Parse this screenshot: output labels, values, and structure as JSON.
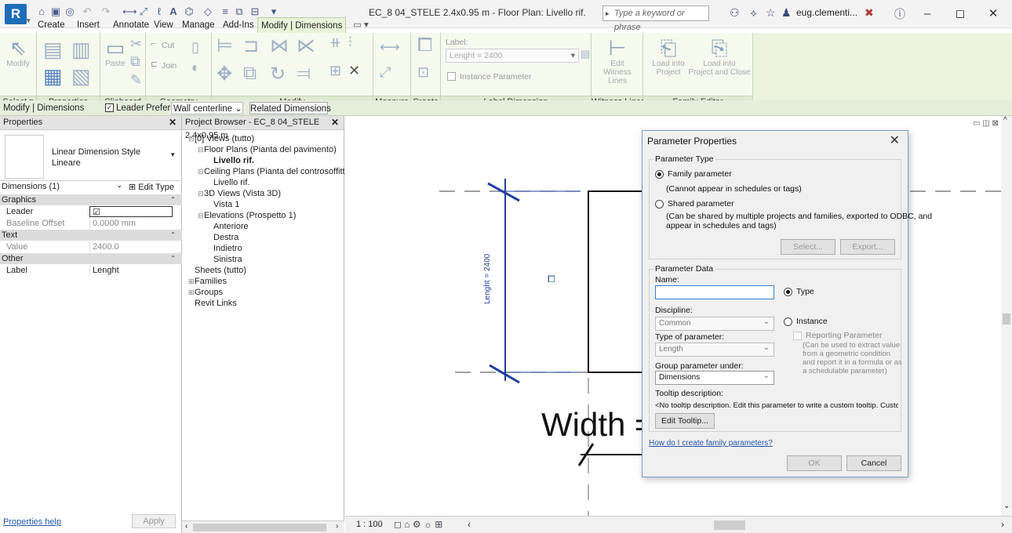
{
  "titlebar": {
    "logo": "R",
    "doc_title": "EC_8 04_STELE 2.4x0.95 m - Floor Plan: Livello rif.",
    "search_placeholder": "Type a keyword or phrase",
    "user": "eug.clementi...",
    "minimize": "–",
    "restore": "◻",
    "close": "✕"
  },
  "tabs": [
    "Create",
    "Insert",
    "Annotate",
    "View",
    "Manage",
    "Add-Ins",
    "Modify | Dimensions"
  ],
  "ribbon": {
    "panels": {
      "select": "Select ▾",
      "properties": "Properties",
      "clipboard": "Clipboard",
      "geometry": "Geometry",
      "modify": "Modify",
      "measure": "Measure",
      "create": "Create",
      "label_dimension": "Label Dimension",
      "witness_lines": "Witness Lines",
      "family_editor": "Family Editor"
    },
    "modify_btn": "Modify",
    "paste_btn": "Paste",
    "cut_btn": "Cut",
    "join_btn": "Join",
    "label_caption": "Label:",
    "label_value": "Lenght = 2400",
    "instance_parameter": "Instance Parameter",
    "edit_witness_1": "Edit",
    "edit_witness_2": "Witness Lines",
    "load_into_project_1": "Load into",
    "load_into_project_2": "Project",
    "load_close_1": "Load into",
    "load_close_2": "Project and Close"
  },
  "optionsbar": {
    "context": "Modify | Dimensions",
    "leader": "Leader",
    "prefer_label": "Prefer:",
    "prefer_value": "Wall centerline",
    "related": "Related Dimensions"
  },
  "properties": {
    "header": "Properties",
    "type_name": "Linear Dimension Style",
    "type_sub": "Lineare",
    "selector": "Dimensions (1)",
    "edit_type": "Edit Type",
    "rows": [
      {
        "kind": "cat",
        "k": "Graphics"
      },
      {
        "kind": "row",
        "k": "Leader",
        "v": "☑"
      },
      {
        "kind": "faint",
        "k": "Baseline Offset",
        "v": "0.0000 mm"
      },
      {
        "kind": "cat",
        "k": "Text"
      },
      {
        "kind": "faint",
        "k": "Value",
        "v": "2400.0"
      },
      {
        "kind": "cat",
        "k": "Other"
      },
      {
        "kind": "row",
        "k": "Label",
        "v": "Lenght"
      }
    ],
    "help": "Properties help",
    "apply": "Apply"
  },
  "browser": {
    "header": "Project Browser - EC_8 04_STELE 2.4x0.95 m",
    "nodes": [
      {
        "t": "[0] Views (tutto)",
        "d": 0,
        "tw": "⊟"
      },
      {
        "t": "Floor Plans (Pianta del pavimento)",
        "d": 1,
        "tw": "⊟"
      },
      {
        "t": "Livello rif.",
        "d": 2,
        "tw": "",
        "bold": true
      },
      {
        "t": "Ceiling Plans (Pianta del controsoffitto",
        "d": 1,
        "tw": "⊟"
      },
      {
        "t": "Livello rif.",
        "d": 2,
        "tw": ""
      },
      {
        "t": "3D Views (Vista 3D)",
        "d": 1,
        "tw": "⊟"
      },
      {
        "t": "Vista 1",
        "d": 2,
        "tw": ""
      },
      {
        "t": "Elevations (Prospetto 1)",
        "d": 1,
        "tw": "⊟"
      },
      {
        "t": "Anteriore",
        "d": 2,
        "tw": ""
      },
      {
        "t": "Destra",
        "d": 2,
        "tw": ""
      },
      {
        "t": "Indietro",
        "d": 2,
        "tw": ""
      },
      {
        "t": "Sinistra",
        "d": 2,
        "tw": ""
      },
      {
        "t": "Sheets (tutto)",
        "d": 0,
        "tw": ""
      },
      {
        "t": "Families",
        "d": 0,
        "tw": "⊞"
      },
      {
        "t": "Groups",
        "d": 0,
        "tw": "⊞"
      },
      {
        "t": "Revit Links",
        "d": 0,
        "tw": ""
      }
    ]
  },
  "canvas": {
    "dim_text": "Lenght = 2400",
    "width_text": "Width =",
    "scale": "1 : 100",
    "view_controls": "◻ ⌂ ⚙ ☼ ⊞"
  },
  "dialog": {
    "title": "Parameter Properties",
    "param_type": "Parameter Type",
    "family_param": "Family parameter",
    "family_note": "(Cannot appear in schedules or tags)",
    "shared_param": "Shared parameter",
    "shared_note1": "(Can be shared by multiple projects and families, exported to ODBC, and",
    "shared_note2": "appear in schedules and tags)",
    "select_btn": "Select...",
    "export_btn": "Export...",
    "param_data": "Parameter Data",
    "name_label": "Name:",
    "name_value": "",
    "type_radio": "Type",
    "discipline_label": "Discipline:",
    "discipline_value": "Common",
    "instance_radio": "Instance",
    "reporting": "Reporting Parameter",
    "reporting_note1": "(Can be used to extract value",
    "reporting_note2": "from a geometric condition",
    "reporting_note3": "and report it in a formula or as",
    "reporting_note4": "a schedulable parameter)",
    "type_of_param_label": "Type of parameter:",
    "type_of_param_value": "Length",
    "group_label": "Group parameter under:",
    "group_value": "Dimensions",
    "tooltip_label": "Tooltip description:",
    "tooltip_value": "<No tooltip description. Edit this parameter to write a custom tooltip. Custom ...",
    "edit_tooltip": "Edit Tooltip...",
    "help_link": "How do I create family parameters?",
    "ok": "OK",
    "cancel": "Cancel"
  }
}
